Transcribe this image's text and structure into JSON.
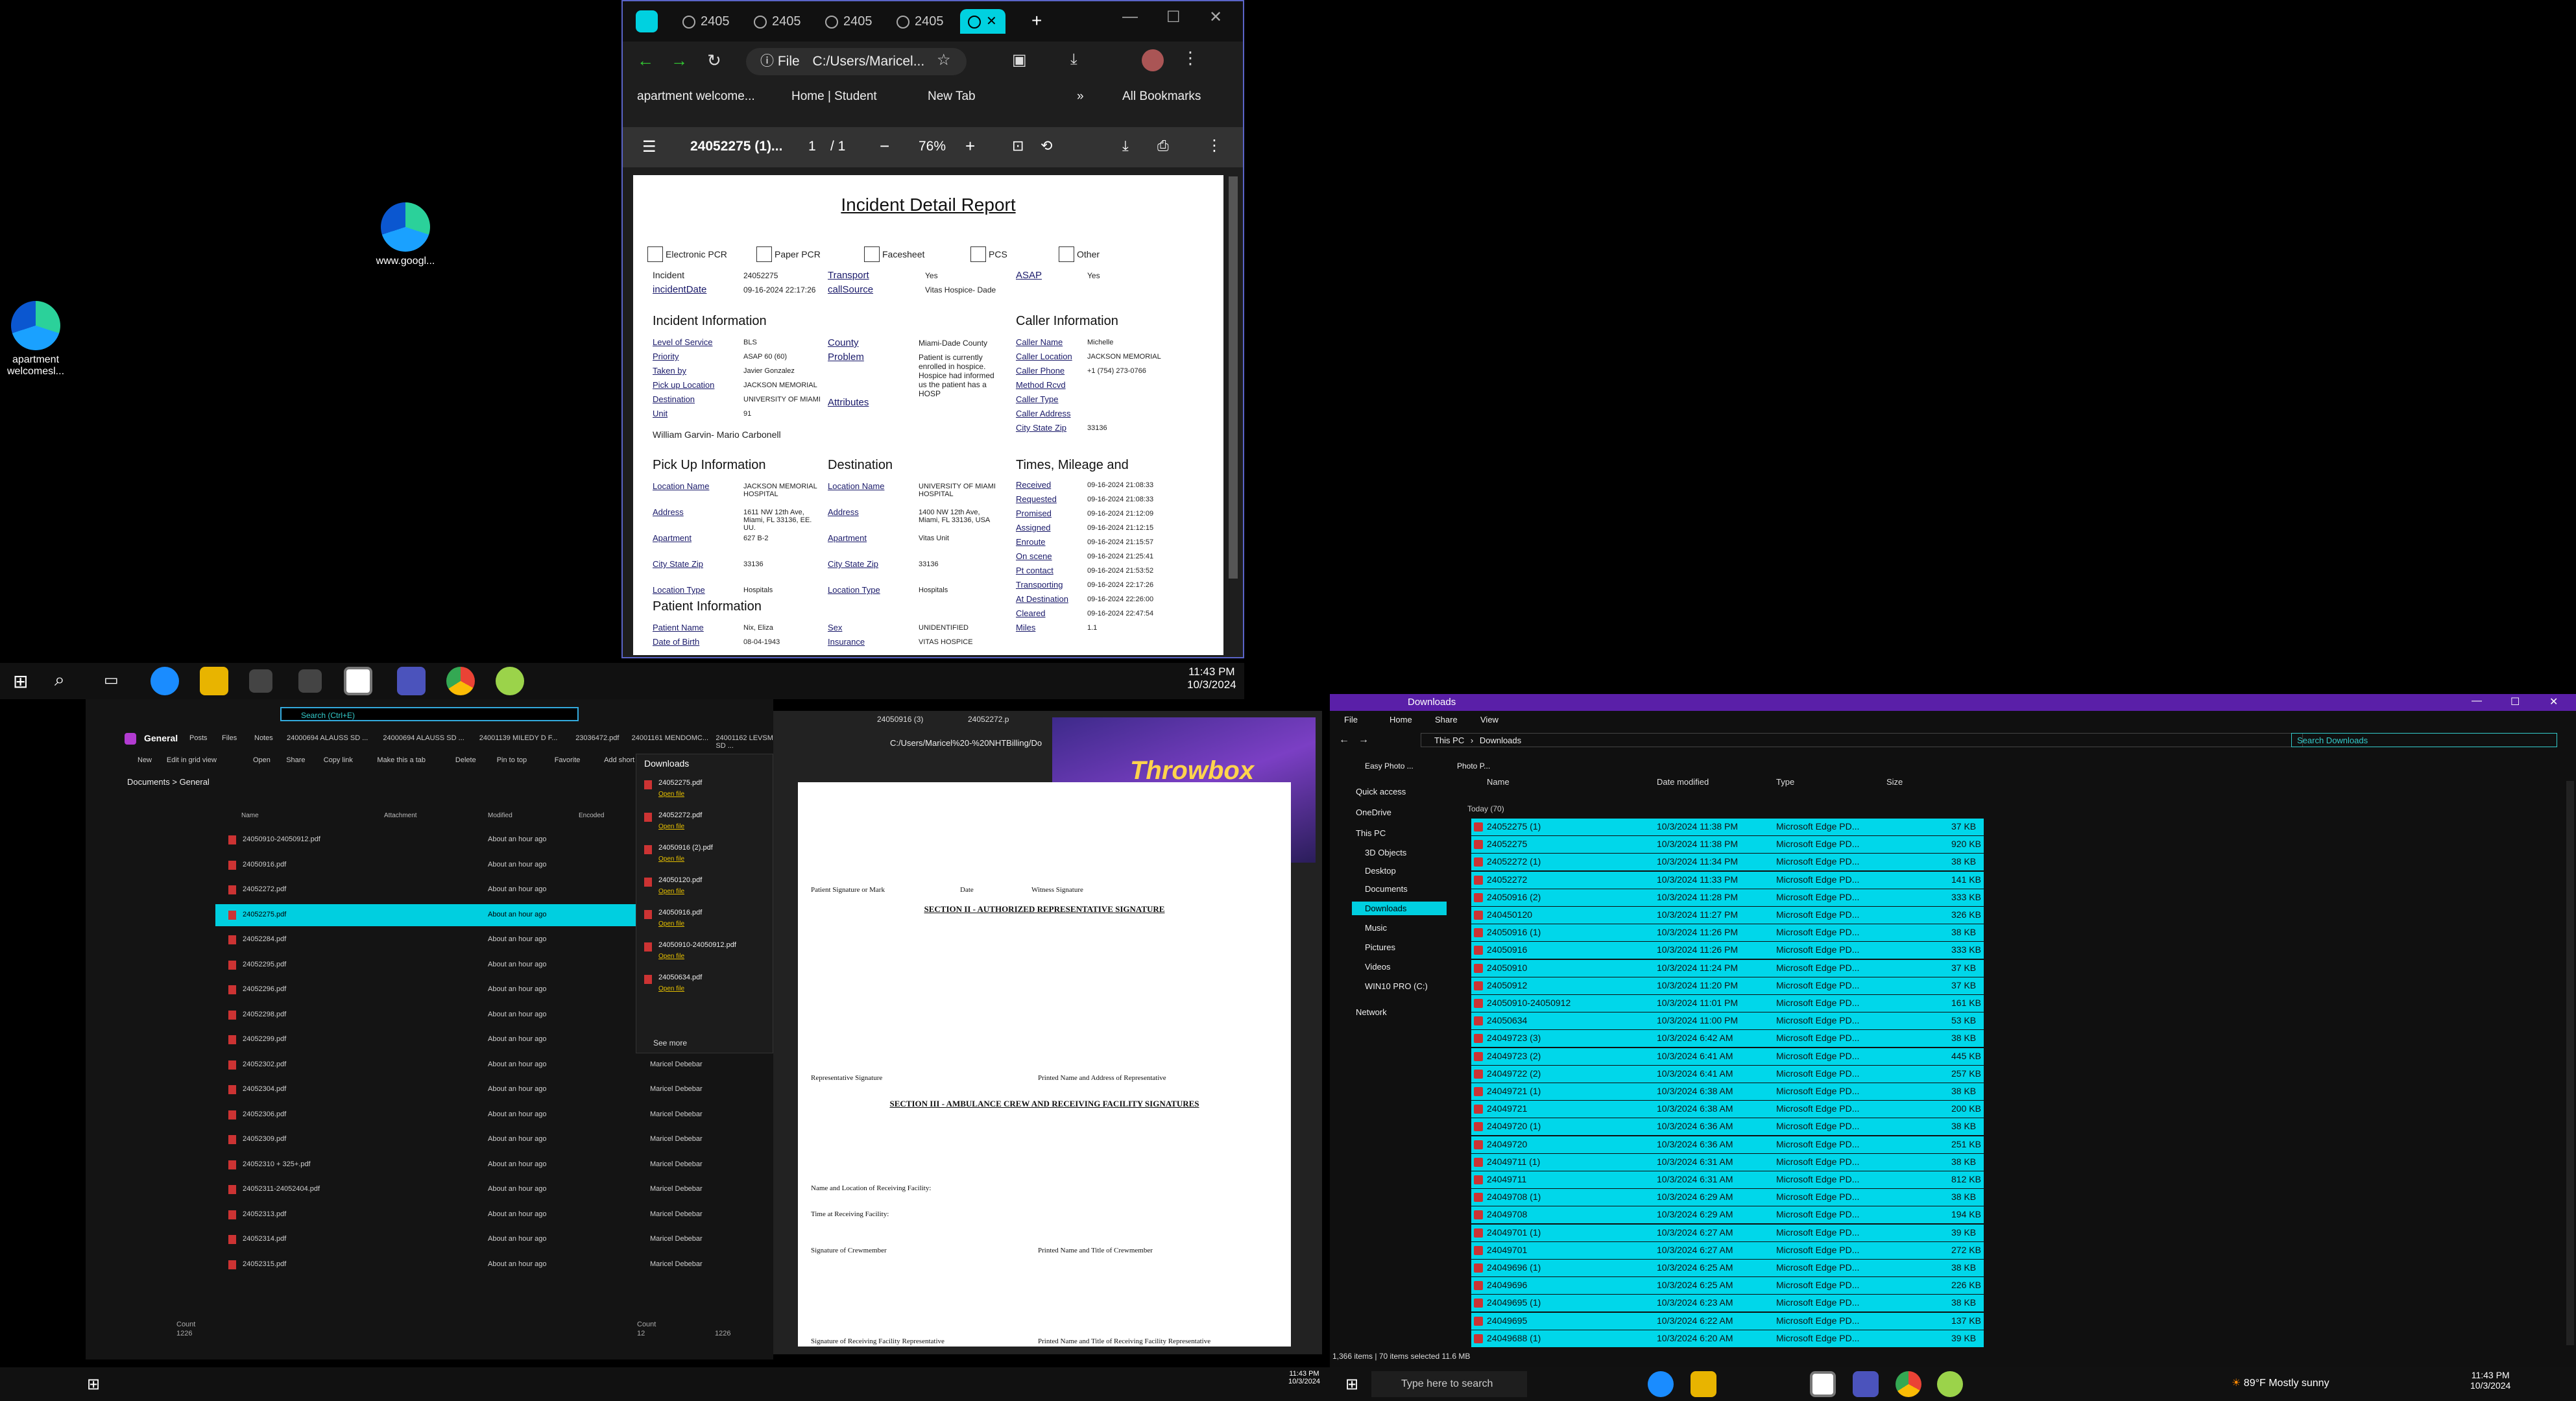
{
  "desktop": {
    "icons": [
      {
        "label": "www.googl..."
      },
      {
        "label": "apartment welcomesl..."
      }
    ]
  },
  "chrome": {
    "tabs": [
      {
        "label": "2405"
      },
      {
        "label": "2405"
      },
      {
        "label": "2405"
      },
      {
        "label": "2405"
      }
    ],
    "address": "C:/Users/Maricel...",
    "file_label": "File",
    "bookmarks": [
      "apartment welcome...",
      "Home | Student",
      "New Tab"
    ],
    "all_bookmarks": "All Bookmarks",
    "pdf_title": "24052275 (1)...",
    "page_current": "1",
    "page_total": "/ 1",
    "zoom": "76%",
    "report": {
      "title": "Incident Detail Report",
      "checkboxes": [
        "Electronic PCR",
        "Paper PCR",
        "Facesheet",
        "PCS",
        "Other"
      ],
      "incident_label": "Incident",
      "incident_value": "24052275",
      "incident_date_label": "incidentDate",
      "incident_date_value": "09-16-2024 22:17:26",
      "transport_label": "Transport",
      "transport_value": "Yes",
      "callsource_label": "callSource",
      "callsource_value": "Vitas Hospice- Dade",
      "asap_label": "ASAP",
      "asap_value": "Yes",
      "incident_info": "Incident Information",
      "caller_info": "Caller Information",
      "pickup_info": "Pick Up Information",
      "destination_info": "Destination",
      "times_info": "Times, Mileage and",
      "patient_info": "Patient Information",
      "left_fields": [
        {
          "k": "Level of Service",
          "v": "BLS"
        },
        {
          "k": "Priority",
          "v": "ASAP 60 (60)"
        },
        {
          "k": "Taken by",
          "v": "Javier Gonzalez"
        },
        {
          "k": "Pick up Location",
          "v": "JACKSON MEMORIAL"
        },
        {
          "k": "Destination",
          "v": "UNIVERSITY OF MIAMI"
        },
        {
          "k": "Unit",
          "v": "91"
        }
      ],
      "crew": "William Garvin- Mario Carbonell",
      "county_label": "County",
      "county_value": "Miami-Dade County",
      "problem_label": "Problem",
      "problem_value": "Patient is currently enrolled in hospice. Hospice had informed us the patient has a HOSP",
      "attributes_label": "Attributes",
      "caller_fields": [
        {
          "k": "Caller Name",
          "v": "Michelle"
        },
        {
          "k": "Caller Location",
          "v": "JACKSON MEMORIAL"
        },
        {
          "k": "Caller Phone",
          "v": "+1 (754) 273-0766"
        },
        {
          "k": "Method Rcvd",
          "v": ""
        },
        {
          "k": "Caller Type",
          "v": ""
        },
        {
          "k": "Caller Address",
          "v": ""
        },
        {
          "k": "City State Zip",
          "v": "33136"
        }
      ],
      "pickup_fields": [
        {
          "k": "Location Name",
          "v": "JACKSON MEMORIAL HOSPITAL"
        },
        {
          "k": "Address",
          "v": "1611 NW 12th Ave, Miami, FL 33136, EE. UU."
        },
        {
          "k": "Apartment",
          "v": "627 B-2"
        },
        {
          "k": "City State Zip",
          "v": "33136"
        },
        {
          "k": "Location Type",
          "v": "Hospitals"
        }
      ],
      "dest_fields": [
        {
          "k": "Location Name",
          "v": "UNIVERSITY OF MIAMI HOSPITAL"
        },
        {
          "k": "Address",
          "v": "1400 NW 12th Ave, Miami, FL 33136, USA"
        },
        {
          "k": "Apartment",
          "v": "Vitas Unit"
        },
        {
          "k": "City State Zip",
          "v": "33136"
        },
        {
          "k": "Location Type",
          "v": "Hospitals"
        }
      ],
      "times": [
        {
          "k": "Received",
          "v": "09-16-2024 21:08:33"
        },
        {
          "k": "Requested",
          "v": "09-16-2024 21:08:33"
        },
        {
          "k": "Promised",
          "v": "09-16-2024 21:12:09"
        },
        {
          "k": "Assigned",
          "v": "09-16-2024 21:12:15"
        },
        {
          "k": "Enroute",
          "v": "09-16-2024 21:15:57"
        },
        {
          "k": "On scene",
          "v": "09-16-2024 21:25:41"
        },
        {
          "k": "Pt contact",
          "v": "09-16-2024 21:53:52"
        },
        {
          "k": "Transporting",
          "v": "09-16-2024 22:17:26"
        },
        {
          "k": "At Destination",
          "v": "09-16-2024 22:26:00"
        },
        {
          "k": "Cleared",
          "v": "09-16-2024 22:47:54"
        },
        {
          "k": "Miles",
          "v": "1.1"
        }
      ],
      "patient_fields": [
        {
          "k": "Patient Name",
          "v": "Nix, Eliza"
        },
        {
          "k": "Date of Birth",
          "v": "08-04-1943"
        },
        {
          "k": "Sex",
          "v": "UNIDENTIFIED"
        },
        {
          "k": "Insurance",
          "v": "VITAS HOSPICE"
        }
      ]
    }
  },
  "top_taskbar": {
    "time": "11:43 PM",
    "date": "10/3/2024"
  },
  "teams": {
    "search_placeholder": "Search (Ctrl+E)",
    "channel": "General",
    "tabs": [
      "Posts",
      "Files",
      "Notes",
      "24000694 ALAUSS SD ...",
      "24000694 ALAUSS SD ...",
      "24001139 MILEDY D F...",
      "23036472.pdf",
      "24001161 MENDOMC...",
      "24001162 LEVSM SD ..."
    ],
    "toolbar": [
      "New",
      "Edit in grid view",
      "Open",
      "Share",
      "Copy link",
      "Make this a tab",
      "Delete",
      "Pin to top",
      "Favorite",
      "Add short"
    ],
    "breadcrumb": "Documents > General",
    "columns": [
      "Name",
      "Attachment",
      "Modified",
      "Encoded"
    ],
    "files": [
      "24050910-24050912.pdf",
      "24050916.pdf",
      "24052272.pdf",
      "24052275.pdf",
      "24052284.pdf",
      "24052295.pdf",
      "24052296.pdf",
      "24052298.pdf",
      "24052299.pdf",
      "24052302.pdf",
      "24052304.pdf",
      "24052306.pdf",
      "24052309.pdf",
      "24052310 + 325+.pdf",
      "24052311-24052404.pdf",
      "24052313.pdf",
      "24052314.pdf",
      "24052315.pdf"
    ],
    "modified": "About an hour ago",
    "person": "Maricel Debebar",
    "downloads_title": "Downloads",
    "downloads": [
      "24052275.pdf",
      "24052272.pdf",
      "24050916 (2).pdf",
      "24050120.pdf",
      "24050916.pdf",
      "24050910-24050912.pdf",
      "24050634.pdf"
    ],
    "open_file": "Open file",
    "see_more": "See more",
    "footer": [
      "Count",
      "1226",
      "Count",
      "12",
      "1226"
    ]
  },
  "pdf2": {
    "tabs": [
      "24050916 (3)",
      "24052272.p"
    ],
    "address": "C:/Users/Maricel%20-%20NHTBilling/Do",
    "overlay_title": "Throwbox",
    "sec2_title": "SECTION II - AUTHORIZED REPRESENTATIVE SIGNATURE",
    "sec3_title": "SECTION III - AMBULANCE CREW AND RECEIVING FACILITY SIGNATURES",
    "lines": [
      "Patient Signature or Mark",
      "Date",
      "Witness Signature",
      "Representative Signature",
      "Printed Name and Address of Representative",
      "Signature of Crewmember",
      "Printed Name and Title of Crewmember",
      "Name and Location of Receiving Facility:",
      "Time at Receiving Facility:",
      "Signature of Receiving Facility Representative",
      "Printed Name and Title of Receiving Facility Representative"
    ],
    "bottom_time": "11:43 PM",
    "bottom_date": "10/3/2024"
  },
  "explorer": {
    "title": "Downloads",
    "menu": [
      "File",
      "Home",
      "Share",
      "View"
    ],
    "path": [
      "This PC",
      "Downloads"
    ],
    "search_placeholder": "Search Downloads",
    "quick_bar": [
      "Easy Photo ...",
      "Photo P..."
    ],
    "nav": [
      "Quick access",
      "OneDrive",
      "This PC",
      "3D Objects",
      "Desktop",
      "Documents",
      "Downloads",
      "Music",
      "Pictures",
      "Videos",
      "WIN10 PRO (C:)",
      "Network"
    ],
    "columns": [
      "Name",
      "Date modified",
      "Type",
      "Size"
    ],
    "group": "Today (70)",
    "files": [
      {
        "n": "24052275 (1)",
        "d": "10/3/2024 11:38 PM",
        "s": "37 KB"
      },
      {
        "n": "24052275",
        "d": "10/3/2024 11:38 PM",
        "s": "920 KB"
      },
      {
        "n": "24052272 (1)",
        "d": "10/3/2024 11:34 PM",
        "s": "38 KB"
      },
      {
        "n": "24052272",
        "d": "10/3/2024 11:33 PM",
        "s": "141 KB"
      },
      {
        "n": "24050916 (2)",
        "d": "10/3/2024 11:28 PM",
        "s": "333 KB"
      },
      {
        "n": "240450120",
        "d": "10/3/2024 11:27 PM",
        "s": "326 KB"
      },
      {
        "n": "24050916 (1)",
        "d": "10/3/2024 11:26 PM",
        "s": "38 KB"
      },
      {
        "n": "24050916",
        "d": "10/3/2024 11:26 PM",
        "s": "333 KB"
      },
      {
        "n": "24050910",
        "d": "10/3/2024 11:24 PM",
        "s": "37 KB"
      },
      {
        "n": "24050912",
        "d": "10/3/2024 11:20 PM",
        "s": "37 KB"
      },
      {
        "n": "24050910-24050912",
        "d": "10/3/2024 11:01 PM",
        "s": "161 KB"
      },
      {
        "n": "24050634",
        "d": "10/3/2024 11:00 PM",
        "s": "53 KB"
      },
      {
        "n": "24049723 (3)",
        "d": "10/3/2024 6:42 AM",
        "s": "38 KB"
      },
      {
        "n": "24049723 (2)",
        "d": "10/3/2024 6:41 AM",
        "s": "445 KB"
      },
      {
        "n": "24049722 (2)",
        "d": "10/3/2024 6:41 AM",
        "s": "257 KB"
      },
      {
        "n": "24049721 (1)",
        "d": "10/3/2024 6:38 AM",
        "s": "38 KB"
      },
      {
        "n": "24049721",
        "d": "10/3/2024 6:38 AM",
        "s": "200 KB"
      },
      {
        "n": "24049720 (1)",
        "d": "10/3/2024 6:36 AM",
        "s": "38 KB"
      },
      {
        "n": "24049720",
        "d": "10/3/2024 6:36 AM",
        "s": "251 KB"
      },
      {
        "n": "24049711 (1)",
        "d": "10/3/2024 6:31 AM",
        "s": "38 KB"
      },
      {
        "n": "24049711",
        "d": "10/3/2024 6:31 AM",
        "s": "812 KB"
      },
      {
        "n": "24049708 (1)",
        "d": "10/3/2024 6:29 AM",
        "s": "38 KB"
      },
      {
        "n": "24049708",
        "d": "10/3/2024 6:29 AM",
        "s": "194 KB"
      },
      {
        "n": "24049701 (1)",
        "d": "10/3/2024 6:27 AM",
        "s": "39 KB"
      },
      {
        "n": "24049701",
        "d": "10/3/2024 6:27 AM",
        "s": "272 KB"
      },
      {
        "n": "24049696 (1)",
        "d": "10/3/2024 6:25 AM",
        "s": "38 KB"
      },
      {
        "n": "24049696",
        "d": "10/3/2024 6:25 AM",
        "s": "226 KB"
      },
      {
        "n": "24049695 (1)",
        "d": "10/3/2024 6:23 AM",
        "s": "38 KB"
      },
      {
        "n": "24049695",
        "d": "10/3/2024 6:22 AM",
        "s": "137 KB"
      },
      {
        "n": "24049688 (1)",
        "d": "10/3/2024 6:20 AM",
        "s": "39 KB"
      }
    ],
    "type": "Microsoft Edge PD...",
    "status": "1,366 items | 70 items selected 11.6 MB"
  },
  "bottom_taskbar": {
    "search_placeholder": "Type here to search",
    "weather": "89°F  Mostly sunny",
    "time": "11:43 PM",
    "date": "10/3/2024"
  }
}
